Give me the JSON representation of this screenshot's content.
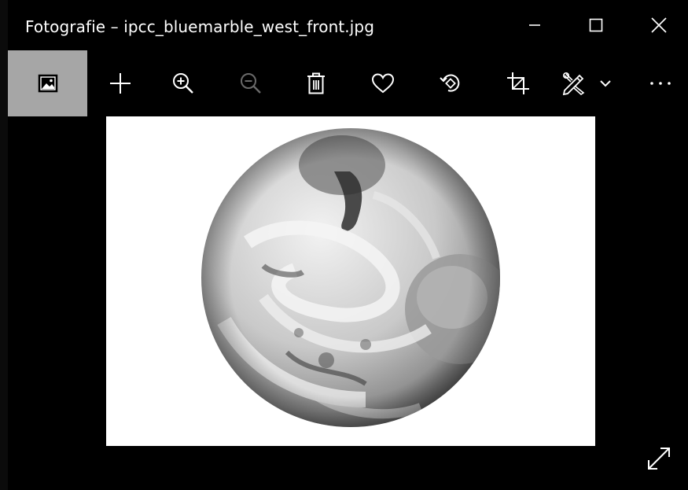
{
  "window": {
    "title": "Fotografie – ipcc_bluemarble_west_front.jpg",
    "controls": {
      "minimize": "minimize-icon",
      "maximize": "maximize-icon",
      "close": "close-icon"
    }
  },
  "toolbar": {
    "items": [
      {
        "icon": "image-icon",
        "active": true
      },
      {
        "icon": "add-icon"
      },
      {
        "icon": "zoom-in-icon"
      },
      {
        "icon": "zoom-out-icon",
        "disabled": true
      },
      {
        "icon": "delete-icon"
      },
      {
        "icon": "heart-icon"
      },
      {
        "icon": "rotate-icon"
      },
      {
        "icon": "crop-icon"
      },
      {
        "icon": "edit-draw-icon"
      },
      {
        "icon": "chevron-down-icon"
      },
      {
        "icon": "more-icon"
      }
    ]
  },
  "viewer": {
    "image_subject": "earth-globe",
    "fullscreen_icon": "fullscreen-expand-icon"
  },
  "colors": {
    "background": "#000000",
    "active_tool": "#a6a6a6",
    "icon": "#ffffff",
    "disabled_icon": "#6a6a6a"
  }
}
